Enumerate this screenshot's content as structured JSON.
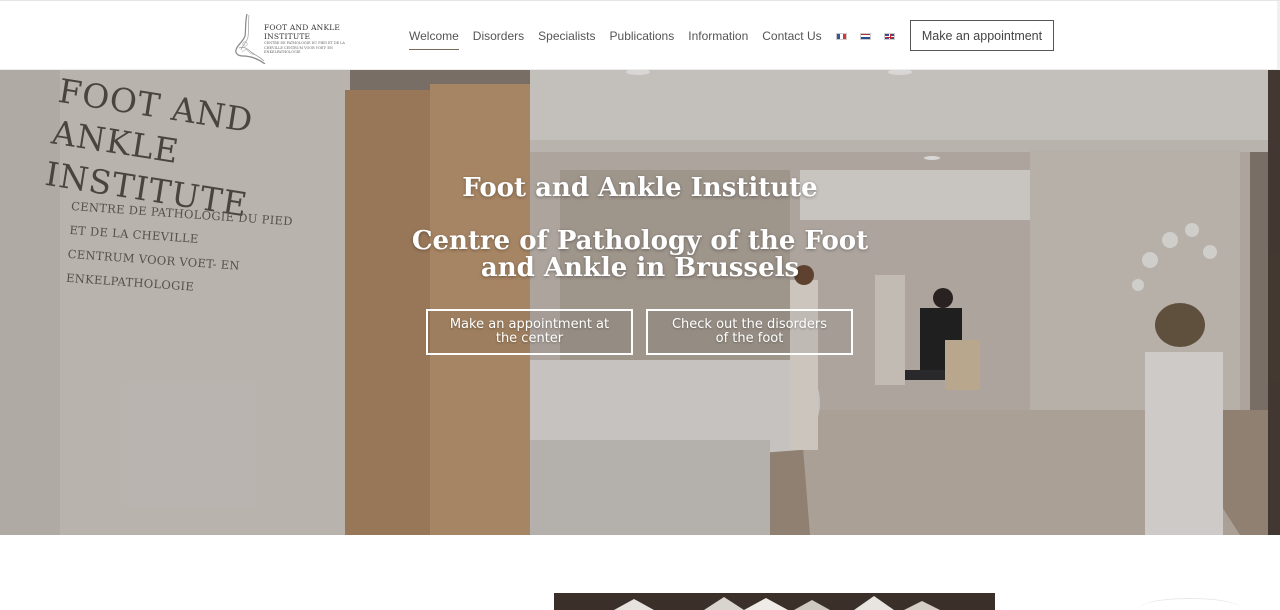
{
  "header": {
    "logo": {
      "title": "FOOT AND ANKLE INSTITUTE",
      "subtitle": "CENTRE DE PATHOLOGIE DU PIED ET DE LA CHEVILLE CENTRUM VOOR VOET- EN ENKELPATHOLOGIE"
    },
    "nav": [
      {
        "label": "Welcome",
        "active": true
      },
      {
        "label": "Disorders",
        "active": false
      },
      {
        "label": "Specialists",
        "active": false
      },
      {
        "label": "Publications",
        "active": false
      },
      {
        "label": "Information",
        "active": false
      },
      {
        "label": "Contact Us",
        "active": false
      }
    ],
    "languages": [
      {
        "code": "fr",
        "icon": "flag-france-icon",
        "colors": [
          "#3a55a0",
          "#ffffff",
          "#d13a3a"
        ]
      },
      {
        "code": "nl",
        "icon": "flag-netherlands-icon",
        "colors": [
          "#b0323a",
          "#ffffff",
          "#2c4a8c"
        ]
      },
      {
        "code": "en",
        "icon": "flag-uk-icon",
        "colors": [
          "#3a4e8c",
          "#ffffff",
          "#c8202f"
        ]
      }
    ],
    "cta_label": "Make an appointment"
  },
  "hero": {
    "wall_title": "FOOT AND ANKLE INSTITUTE",
    "wall_subtitle_1": "Centre de pathologie du pied et de la cheville",
    "wall_subtitle_2": "Centrum voor voet- en enkelpathologie",
    "title": "Foot and Ankle Institute",
    "subtitle": "Centre of Pathology of the Foot and Ankle in Brussels",
    "buttons": [
      {
        "label": "Make an appointment at the center"
      },
      {
        "label": "Check out the disorders of the foot"
      }
    ]
  },
  "colors": {
    "accent_underline": "#7a6a5a",
    "text_dark": "#444444",
    "hero_text": "#ffffff"
  }
}
